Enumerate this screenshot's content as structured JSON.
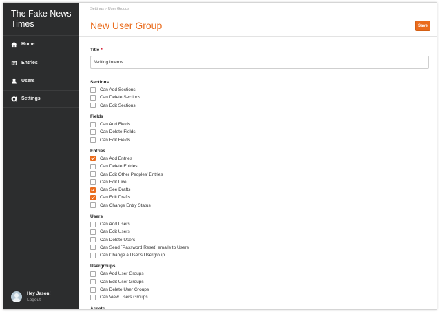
{
  "brand": {
    "line1": "The Fake News",
    "line2": "Times"
  },
  "nav": [
    {
      "label": "Home",
      "icon": "home-icon"
    },
    {
      "label": "Entries",
      "icon": "entries-icon"
    },
    {
      "label": "Users",
      "icon": "user-icon"
    },
    {
      "label": "Settings",
      "icon": "gear-icon"
    }
  ],
  "user": {
    "greeting": "Hey Jason!",
    "logout": "Logout"
  },
  "breadcrumb": {
    "root": "Settings",
    "separator": "›",
    "current": "User Groups"
  },
  "page_title": "New User Group",
  "save_label": "Save",
  "form": {
    "title_label": "Title",
    "required_mark": "*",
    "title_value": "Writing Interns"
  },
  "groups": [
    {
      "title": "Sections",
      "items": [
        {
          "label": "Can Add Sections",
          "checked": false
        },
        {
          "label": "Can Delete Sections",
          "checked": false
        },
        {
          "label": "Can Edit Sections",
          "checked": false
        }
      ]
    },
    {
      "title": "Fields",
      "items": [
        {
          "label": "Can Add Fields",
          "checked": false
        },
        {
          "label": "Can Delete Fields",
          "checked": false
        },
        {
          "label": "Can Edit Fields",
          "checked": false
        }
      ]
    },
    {
      "title": "Entries",
      "items": [
        {
          "label": "Can Add Entries",
          "checked": true
        },
        {
          "label": "Can Delete Entries",
          "checked": false
        },
        {
          "label": "Can Edit Other Peoples' Entries",
          "checked": false
        },
        {
          "label": "Can Edit Live",
          "checked": false
        },
        {
          "label": "Can See Drafts",
          "checked": true
        },
        {
          "label": "Can Edit Drafts",
          "checked": true
        },
        {
          "label": "Can Change Entry Status",
          "checked": false
        }
      ]
    },
    {
      "title": "Users",
      "items": [
        {
          "label": "Can Add Users",
          "checked": false
        },
        {
          "label": "Can Edit Users",
          "checked": false
        },
        {
          "label": "Can Delete Users",
          "checked": false
        },
        {
          "label": "Can Send `Password Reset` emails to Users",
          "checked": false
        },
        {
          "label": "Can Change a User's Usergroup",
          "checked": false
        }
      ]
    },
    {
      "title": "Usergroups",
      "items": [
        {
          "label": "Can Add User Groups",
          "checked": false
        },
        {
          "label": "Can Edit User Groups",
          "checked": false
        },
        {
          "label": "Can Delete User Groups",
          "checked": false
        },
        {
          "label": "Can View Users Groups",
          "checked": false
        }
      ]
    },
    {
      "title": "Assets",
      "items": []
    }
  ],
  "colors": {
    "accent": "#ea6c1d",
    "sidebar": "#2c2d2e"
  }
}
